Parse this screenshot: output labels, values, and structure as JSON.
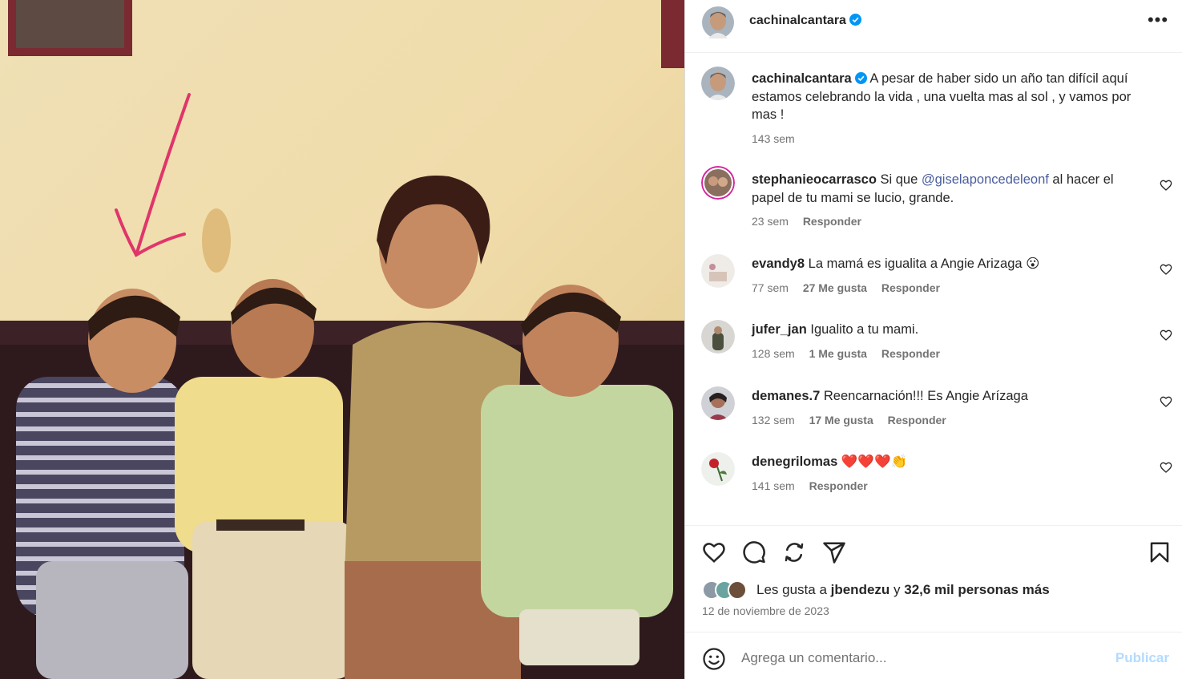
{
  "post": {
    "username": "cachinalcantara",
    "verified": true,
    "caption": "A pesar de haber sido un año tan difícil aquí estamos celebrando la vida , una vuelta mas al sol , y vamos por mas !",
    "caption_time": "143 sem",
    "photo_description_icon": "family-photo"
  },
  "comments": [
    {
      "username": "stephanieocarrasco",
      "text_before": "Si que ",
      "mention": "@giselaponcedeleonf",
      "text_after": " al hacer el papel de tu mami se lucio, grande.",
      "time": "23 sem",
      "likes": "",
      "reply": "Responder"
    },
    {
      "username": "evandy8",
      "text": "La mamá es igualita a Angie Arizaga 😮",
      "time": "77 sem",
      "likes": "27 Me gusta",
      "reply": "Responder"
    },
    {
      "username": "jufer_jan",
      "text": "Igualito a tu mami.",
      "time": "128 sem",
      "likes": "1 Me gusta",
      "reply": "Responder"
    },
    {
      "username": "demanes.7",
      "text": "Reencarnación!!! Es Angie Arízaga",
      "time": "132 sem",
      "likes": "17 Me gusta",
      "reply": "Responder"
    },
    {
      "username": "denegrilomas",
      "text": "❤️❤️❤️👏",
      "time": "141 sem",
      "likes": "",
      "reply": "Responder"
    }
  ],
  "actions": {
    "icons": [
      "heart-icon",
      "comment-icon",
      "repost-icon",
      "share-icon",
      "bookmark-icon"
    ]
  },
  "likes": {
    "prefix": "Les gusta a ",
    "user": "jbendezu",
    "middle": " y ",
    "others": "32,6 mil personas más"
  },
  "date": "12 de noviembre de 2023",
  "composer": {
    "placeholder": "Agrega un comentario...",
    "publish_label": "Publicar"
  },
  "colors": {
    "link": "#4a5d9e",
    "publish_disabled": "#b3dbff",
    "meta": "#737373",
    "verified": "#0095f6"
  }
}
